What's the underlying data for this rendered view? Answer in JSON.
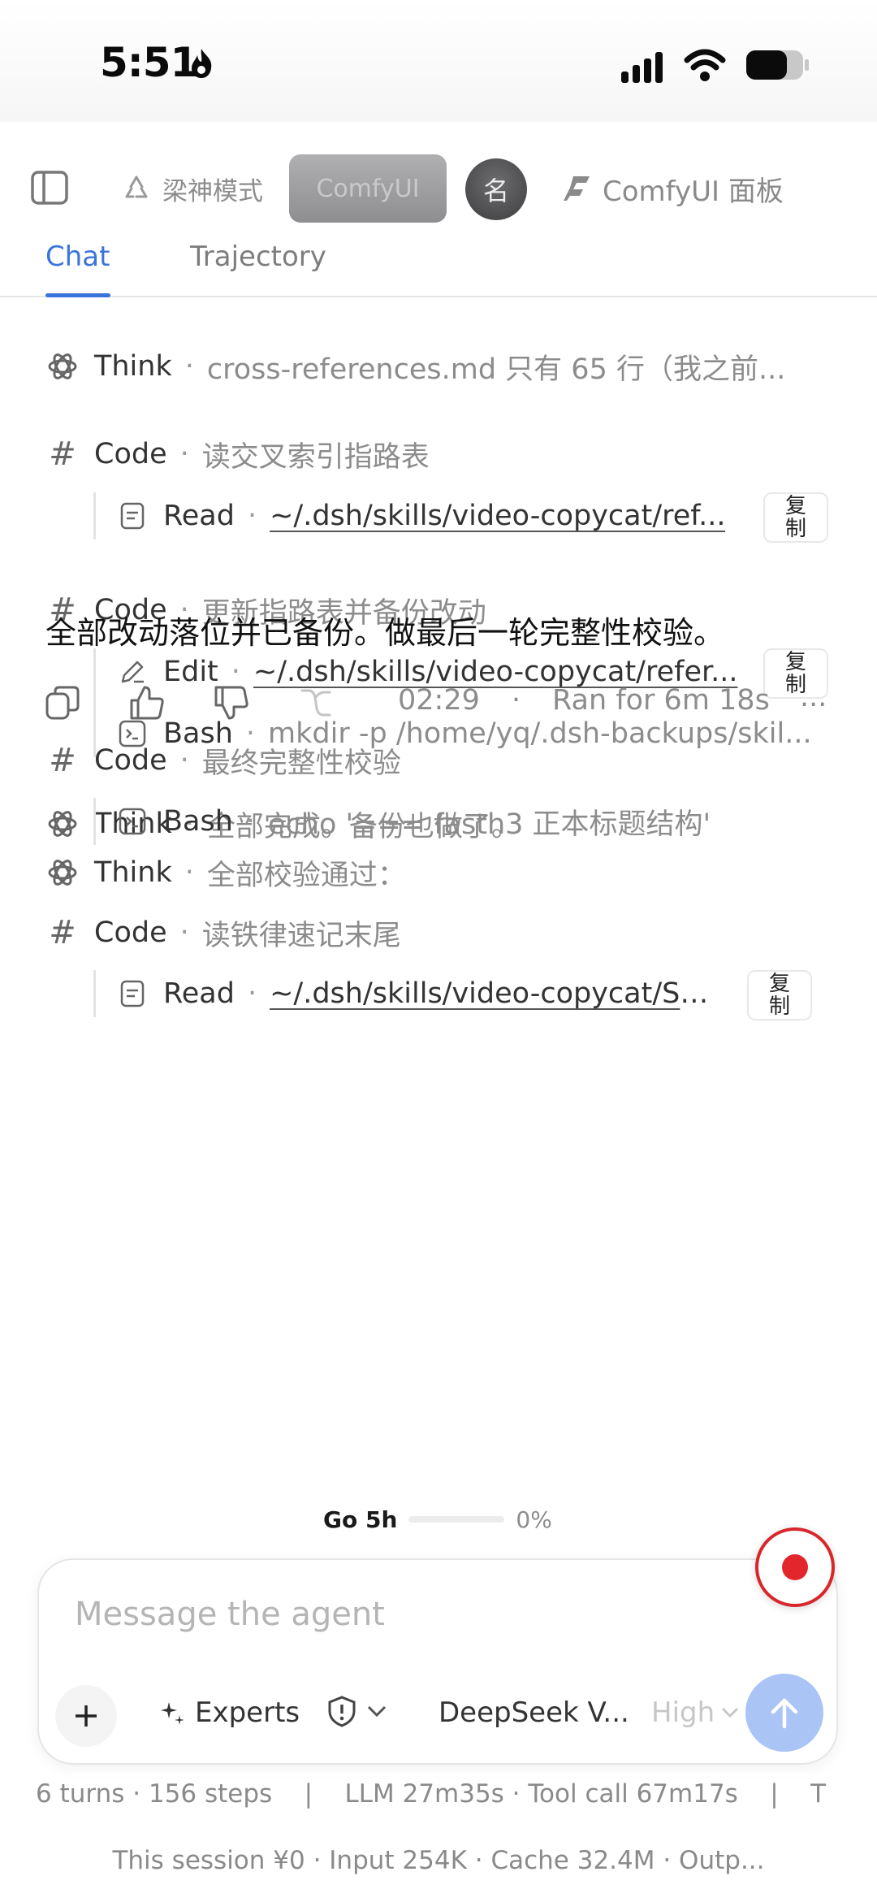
{
  "status_bar": {
    "time": "5:51"
  },
  "toolbar": {
    "mode_label": "梁神模式",
    "comfy_chip": "ComfyUI",
    "avatar_label": "名",
    "panel_label": "ComfyUI 面板"
  },
  "tabs": {
    "chat": "Chat",
    "trajectory": "Trajectory"
  },
  "feed": {
    "think1": {
      "label": "Think",
      "desc": "cross-references.md 只有 65 行（我之前..."
    },
    "code1": {
      "label": "Code",
      "desc": "读交叉索引指路表"
    },
    "read1": {
      "label": "Read",
      "path": "~/.dsh/skills/video-copycat/ref...",
      "copy": "复制"
    },
    "code2": {
      "label": "Code",
      "desc": "更新指路表并备份改动"
    },
    "edit1": {
      "label": "Edit",
      "path": "~/.dsh/skills/video-copycat/refer...",
      "copy": "复制"
    },
    "bash1": {
      "label": "Bash",
      "cmd": "mkdir -p /home/yq/.dsh-backups/skil..."
    },
    "think2": {
      "label": "Think",
      "desc": "全部完成。备份也做了。"
    },
    "answer": "全部改动落位并已备份。做最后一轮完整性校验。",
    "meta": {
      "time": "02:29",
      "sep": "·",
      "ran": "Ran for 6m 18s",
      "more": "..."
    },
    "code3": {
      "label": "Code",
      "desc": "最终完整性校验"
    },
    "bash2": {
      "label": "Bash",
      "cmd": "echo '=== fasth3 正本标题结构'"
    },
    "think3": {
      "label": "Think",
      "desc": "全部校验通过："
    },
    "code4": {
      "label": "Code",
      "desc": "读铁律速记末尾"
    },
    "read2": {
      "label": "Read",
      "path": "~/.dsh/skills/video-copycat/SK...",
      "copy": "复制"
    },
    "dot": "·"
  },
  "quota": {
    "label": "Go 5h",
    "percent_text": "0%",
    "percent": 0
  },
  "composer": {
    "placeholder": "Message the agent",
    "experts": "Experts",
    "model": "DeepSeek V...",
    "effort": "High"
  },
  "footer": {
    "stats": "6 turns · 156 steps    |    LLM 27m35s · Tool call 67m17s    |    T",
    "session": "This session ¥0 · Input 254K · Cache 32.4M · Outp..."
  },
  "colors": {
    "accent": "#3a74db",
    "record": "#e3262b",
    "send": "#a9c4f5"
  }
}
